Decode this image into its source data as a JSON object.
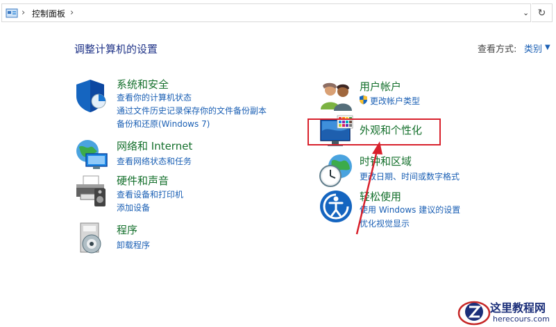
{
  "address_bar": {
    "breadcrumb": "控制面板",
    "icons": [
      "control-panel-icon",
      "chevron-right-icon",
      "chevron-down-icon",
      "refresh-icon"
    ]
  },
  "header": {
    "title": "调整计算机的设置",
    "view_by_label": "查看方式:",
    "view_by_value": "类别"
  },
  "categories": [
    {
      "name": "system-and-security",
      "title": "系统和安全",
      "icon": "shield-icon",
      "links": [
        "查看你的计算机状态",
        "通过文件历史记录保存你的文件备份副本",
        "备份和还原(Windows 7)"
      ]
    },
    {
      "name": "network-and-internet",
      "title": "网络和 Internet",
      "icon": "network-globe-icon",
      "links": [
        "查看网络状态和任务"
      ]
    },
    {
      "name": "hardware-and-sound",
      "title": "硬件和声音",
      "icon": "printer-icon",
      "links": [
        "查看设备和打印机",
        "添加设备"
      ]
    },
    {
      "name": "programs",
      "title": "程序",
      "icon": "programs-disc-icon",
      "links": [
        "卸载程序"
      ]
    },
    {
      "name": "user-accounts",
      "title": "用户帐户",
      "icon": "users-icon",
      "links": [
        "更改帐户类型"
      ]
    },
    {
      "name": "appearance-and-personalization",
      "title": "外观和个性化",
      "icon": "monitor-palette-icon",
      "links": []
    },
    {
      "name": "clock-and-region",
      "title": "时钟和区域",
      "icon": "clock-globe-icon",
      "links": [
        "更改日期、时间或数字格式"
      ]
    },
    {
      "name": "ease-of-access",
      "title": "轻松使用",
      "icon": "ease-of-access-icon",
      "links": [
        "使用 Windows 建议的设置",
        "优化视觉显示"
      ]
    }
  ],
  "annotation": {
    "highlight_color": "#d8202b"
  },
  "watermark": {
    "title": "这里教程网",
    "url": "herecours.com"
  },
  "colors": {
    "title_green": "#136f2b",
    "link_blue": "#1a5fb4",
    "heading_blue": "#1e3287"
  }
}
